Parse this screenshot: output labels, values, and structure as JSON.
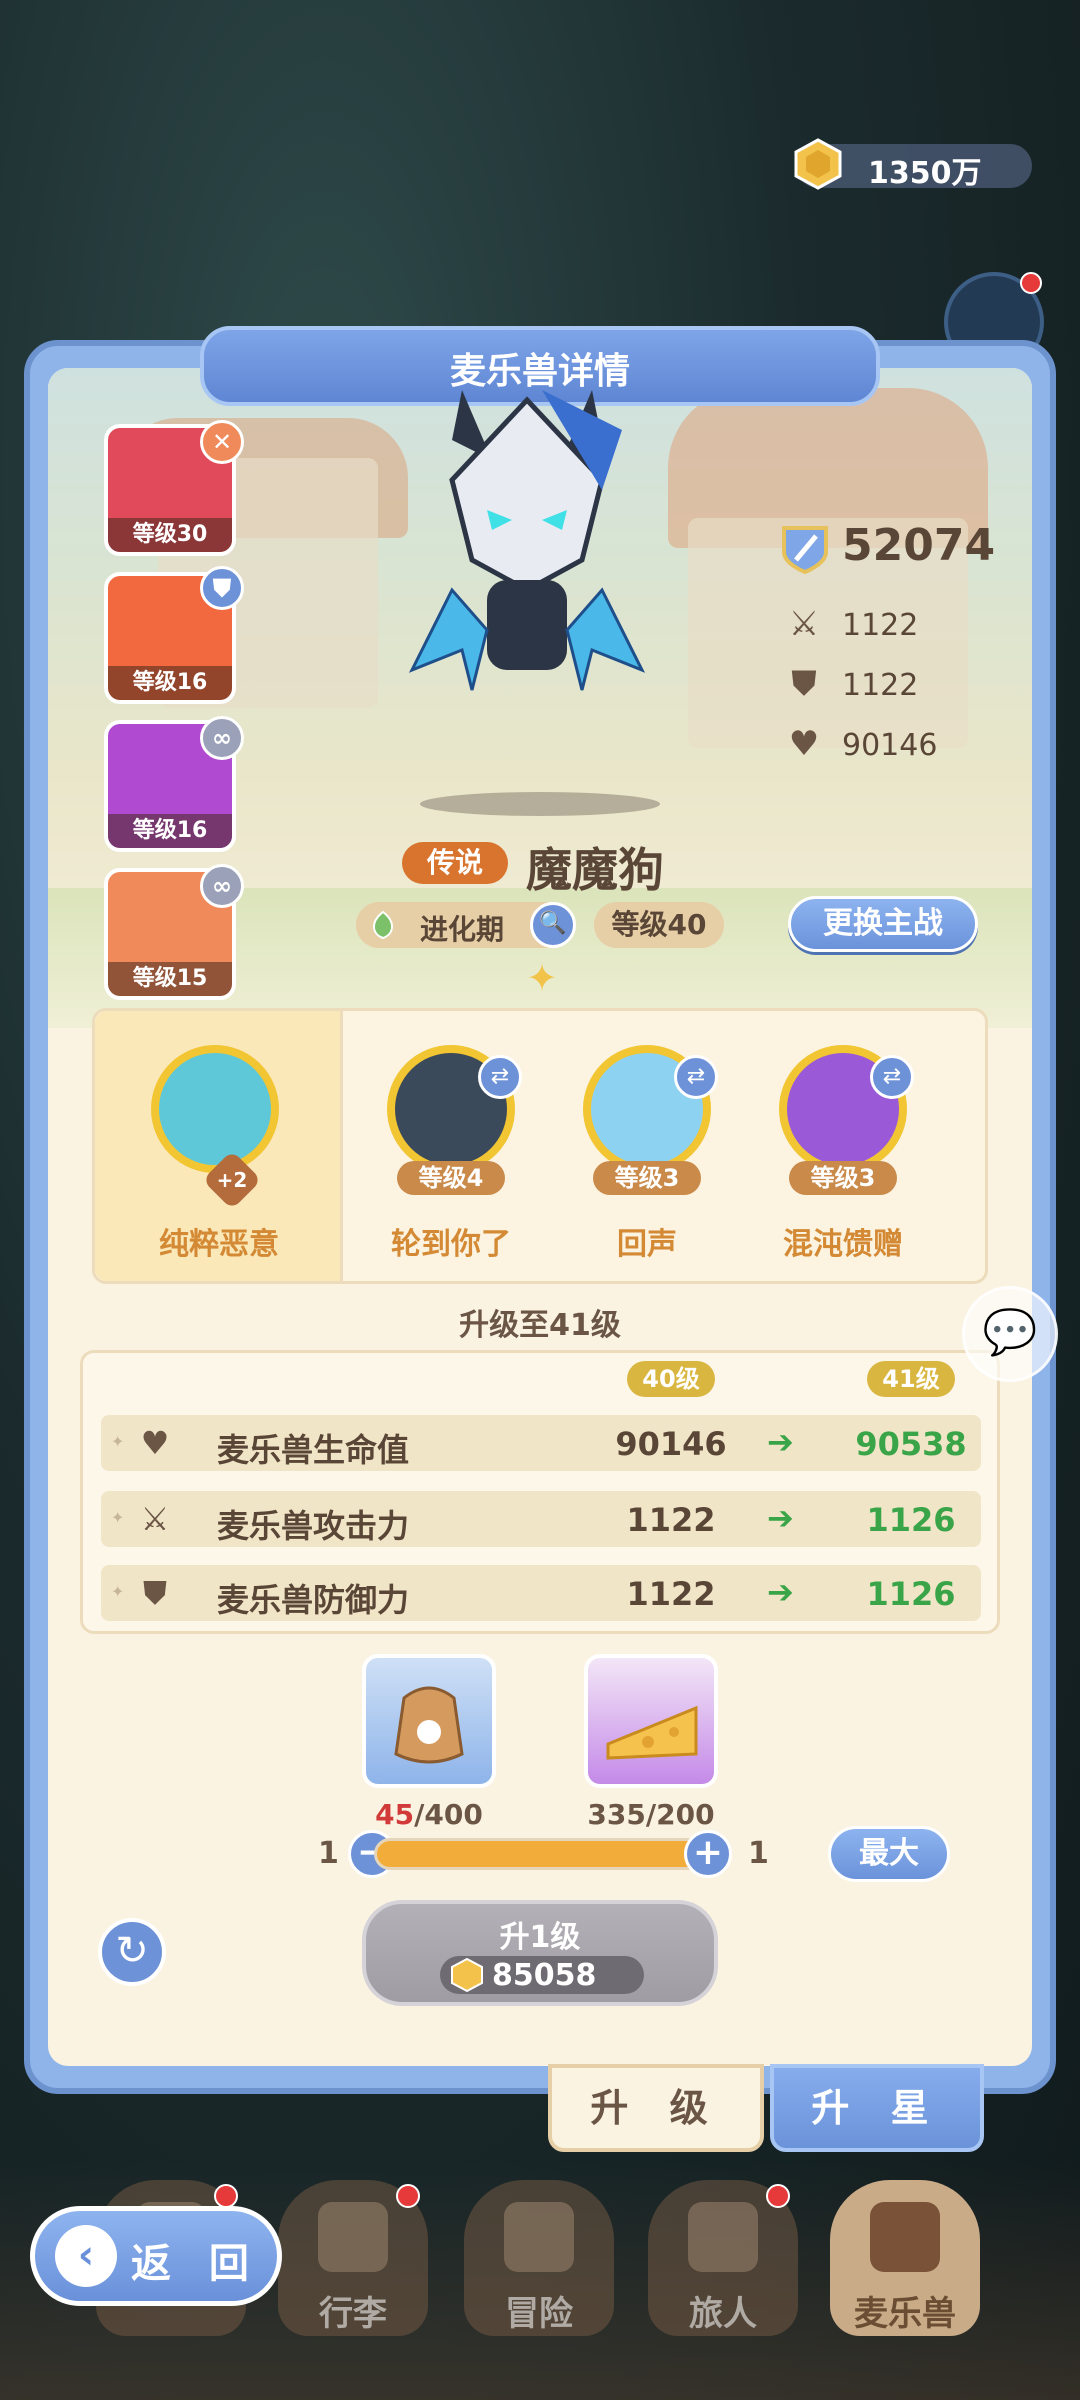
{
  "currency": {
    "amount": "1350万",
    "icon": "gold-coin-icon"
  },
  "title": "麦乐兽详情",
  "skills_left": [
    {
      "level": "等级30",
      "color": "#e04a5a",
      "badge": "✕",
      "badge_color": "#f08a5a"
    },
    {
      "level": "等级16",
      "color": "#f2693f",
      "badge": "⛊",
      "badge_color": "#6e92d8"
    },
    {
      "level": "等级16",
      "color": "#b04ad0",
      "badge": "∞",
      "badge_color": "#9aa1b8"
    },
    {
      "level": "等级15",
      "color": "#f08a5a",
      "badge": "∞",
      "badge_color": "#9aa1b8"
    }
  ],
  "stats": {
    "power": "52074",
    "attack": "1122",
    "defense": "1122",
    "hp": "90146"
  },
  "pet": {
    "rarity": "传说",
    "name": "魔魔狗",
    "evolution": "进化期",
    "level": "等级40",
    "switch_label": "更换主战"
  },
  "pet_skills": {
    "main": {
      "name": "纯粹恶意",
      "plus": "+2",
      "color": "#5ec8d8"
    },
    "others": [
      {
        "name": "轮到你了",
        "level": "等级4",
        "color": "#3b4a5a"
      },
      {
        "name": "回声",
        "level": "等级3",
        "color": "#8ed2f2"
      },
      {
        "name": "混沌馈赠",
        "level": "等级3",
        "color": "#9a5ad8"
      }
    ]
  },
  "upgrade": {
    "heading": "升级至41级",
    "from_level": "40级",
    "to_level": "41级",
    "rows": [
      {
        "icon": "heart-icon",
        "label": "麦乐兽生命值",
        "old": "90146",
        "new": "90538"
      },
      {
        "icon": "swords-icon",
        "label": "麦乐兽攻击力",
        "old": "1122",
        "new": "1126"
      },
      {
        "icon": "shield-icon",
        "label": "麦乐兽防御力",
        "old": "1122",
        "new": "1126"
      }
    ]
  },
  "materials": [
    {
      "name": "food-bag-icon",
      "have": "45",
      "need": "/400",
      "color": "#8eb4ea"
    },
    {
      "name": "cheese-icon",
      "have": "335",
      "need": "/200",
      "color": "#c48ae8"
    }
  ],
  "slider": {
    "min": "1",
    "max": "1",
    "max_label": "最大",
    "fill": 1.0
  },
  "level_up": {
    "label": "升1级",
    "cost": "85058"
  },
  "tabs": {
    "upgrade": "升 级",
    "star": "升 星"
  },
  "nav": [
    {
      "label": "",
      "dot": true
    },
    {
      "label": "行李",
      "dot": true
    },
    {
      "label": "冒险",
      "dot": false
    },
    {
      "label": "旅人",
      "dot": true
    },
    {
      "label": "麦乐兽",
      "dot": false
    }
  ],
  "back": "返 回",
  "colors": {
    "accent_blue": "#6e92d8",
    "panel_bg": "#fbf3e2",
    "increase_green": "#3aa548",
    "deficit_red": "#d23a3a"
  }
}
